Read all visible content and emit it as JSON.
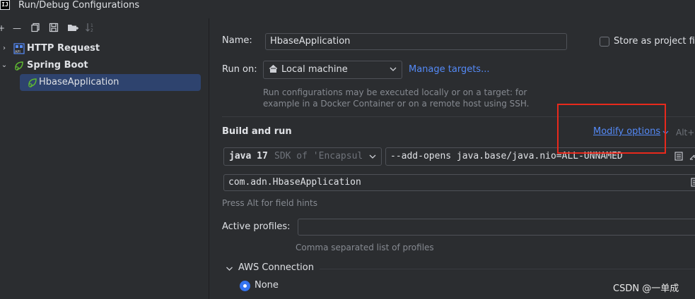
{
  "window": {
    "title": "Run/Debug Configurations",
    "logo_text": "IJ"
  },
  "toolbar": {
    "icons": [
      "add-icon",
      "remove-icon",
      "copy-icon",
      "save-icon",
      "new-folder-icon",
      "sort-icon"
    ]
  },
  "tree": [
    {
      "label": "HTTP Request",
      "icon": "http-request-icon",
      "bold": true,
      "expanded": false
    },
    {
      "label": "Spring Boot",
      "icon": "spring-boot-icon",
      "bold": true,
      "expanded": true
    },
    {
      "label": "HbaseApplication",
      "icon": "spring-app-icon",
      "selected": true
    }
  ],
  "form": {
    "name_label": "Name:",
    "name_value": "HbaseApplication",
    "store_label": "Store as project fil",
    "run_on_label": "Run on:",
    "run_on_value": "Local machine",
    "manage_targets": "Manage targets...",
    "run_on_hint_1": "Run configurations may be executed locally or on a target: for",
    "run_on_hint_2": "example in a Docker Container or on a remote host using SSH.",
    "build_and_run": "Build and run",
    "modify_options": "Modify options",
    "modify_shortcut": "Alt+",
    "jdk_main": "java 17",
    "jdk_detail": "SDK of 'Encapsul",
    "vm_options": "--add-opens java.base/java.nio=ALL-UNNAMED",
    "main_class": "com.adn.HbaseApplication",
    "field_hint": "Press Alt for field hints",
    "active_profiles_label": "Active profiles:",
    "active_profiles_value": "",
    "profiles_hint": "Comma separated list of profiles",
    "aws_section": "AWS Connection",
    "aws_option": "None"
  },
  "watermark": "CSDN @一单成",
  "colors": {
    "accent": "#3574f0",
    "link": "#548af7",
    "selection": "#2e436e",
    "highlight_box": "#e8291c"
  }
}
